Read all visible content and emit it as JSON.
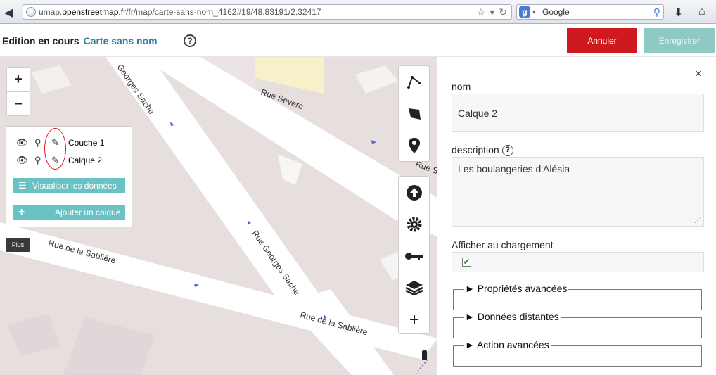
{
  "browser": {
    "url_prefix": "umap.",
    "url_domain": "openstreetmap.fr",
    "url_path": "/fr/map/carte-sans-nom_4162#19/48.83191/2.32417",
    "search_placeholder": "Google"
  },
  "header": {
    "editing_label": "Edition en cours",
    "map_name": "Carte sans nom",
    "help": "?",
    "cancel_label": "Annuler",
    "save_label": "Enregistrer"
  },
  "map": {
    "zoom_in": "+",
    "zoom_out": "−",
    "layers": [
      {
        "label": "Couche 1"
      },
      {
        "label": "Calque 2"
      }
    ],
    "view_data_label": "Visualiser les données",
    "add_layer_label": "Ajouter un calque",
    "more_label": "Plus",
    "streets": [
      {
        "label": "Georges Sache"
      },
      {
        "label": "Rue Severo"
      },
      {
        "label": "Rue Se"
      },
      {
        "label": "Rue de la Sablière"
      },
      {
        "label": "Rue Georges Sache"
      },
      {
        "label": "Rue de la Sablière"
      }
    ]
  },
  "form": {
    "close": "×",
    "name_label": "nom",
    "name_value": "Calque 2",
    "description_label": "description",
    "description_value": "Les boulangeries d'Alésia",
    "display_on_load_label": "Afficher au chargement",
    "display_on_load_checked": "✔",
    "sections": [
      {
        "label": "► Propriétés avancées"
      },
      {
        "label": "► Données distantes"
      },
      {
        "label": "► Action avancées"
      }
    ]
  },
  "colors": {
    "cancel": "#d0181f",
    "save": "#8ec9c4",
    "accent": "#69c2c4",
    "map_name": "#2d7fa0",
    "block": "#e7dede"
  }
}
